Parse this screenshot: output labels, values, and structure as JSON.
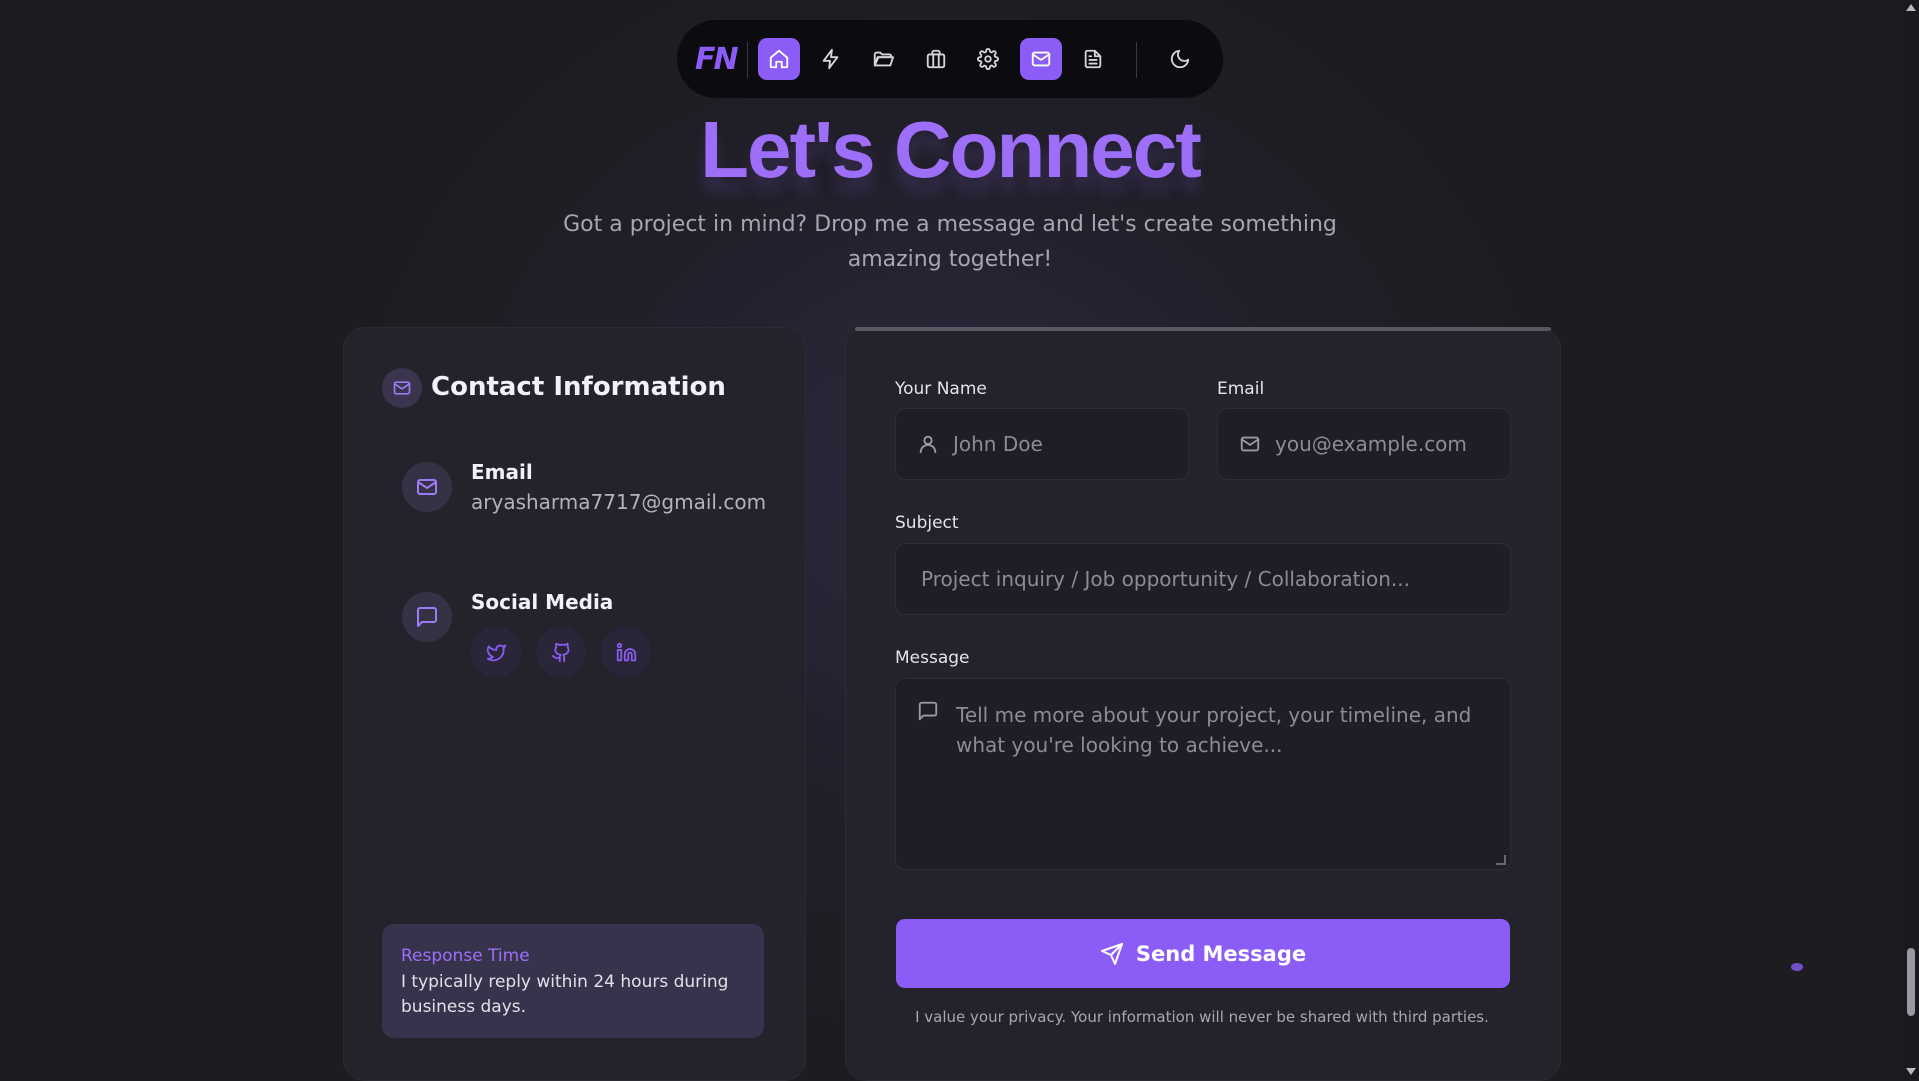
{
  "nav": {
    "logo": "FN",
    "items": [
      "home-icon",
      "bolt-icon",
      "folder-icon",
      "briefcase-icon",
      "gear-icon",
      "mail-icon",
      "document-icon"
    ],
    "theme_toggle": "moon-icon",
    "accent": "#8b5cf6"
  },
  "hero": {
    "title": "Let's Connect",
    "subtitle": "Got a project in mind? Drop me a message and let's create something amazing together!"
  },
  "contact": {
    "title": "Contact Information",
    "email_label": "Email",
    "email_value": "aryasharma7717@gmail.com",
    "social_label": "Social Media",
    "social_icons": [
      "twitter-icon",
      "github-icon",
      "linkedin-icon"
    ],
    "response_title": "Response Time",
    "response_text": "I typically reply within 24 hours during business days."
  },
  "form": {
    "name_label": "Your Name",
    "name_placeholder": "John Doe",
    "email_label": "Email",
    "email_placeholder": "you@example.com",
    "subject_label": "Subject",
    "subject_placeholder": "Project inquiry / Job opportunity / Collaboration...",
    "message_label": "Message",
    "message_placeholder": "Tell me more about your project, your timeline, and what you're looking to achieve...",
    "send_label": "Send Message",
    "privacy_note": "I value your privacy. Your information will never be shared with third parties."
  }
}
